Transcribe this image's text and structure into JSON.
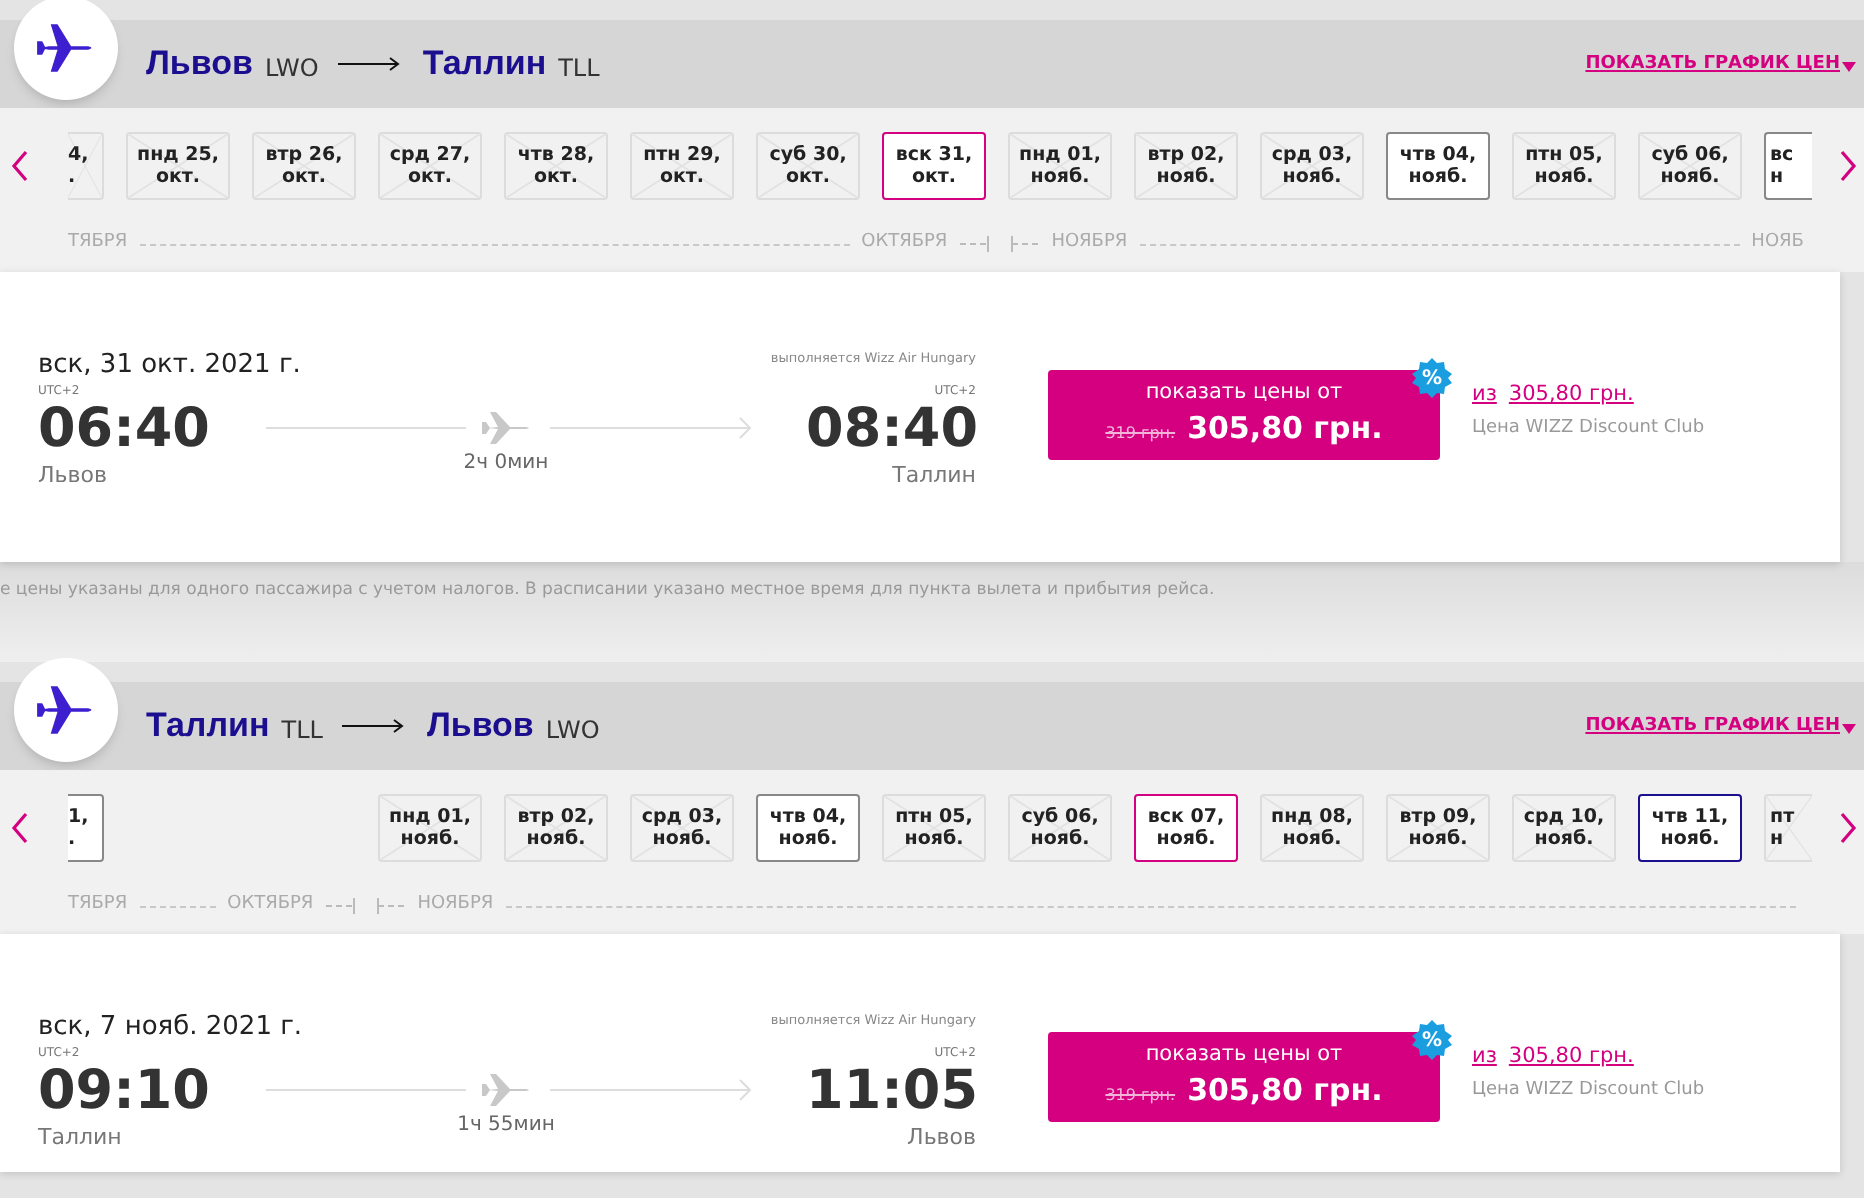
{
  "note": "е цены указаны для одного пассажира с учетом налогов. В расписании указано местное время для пункта вылета и прибытия рейса.",
  "sections": [
    {
      "route": {
        "from": "Львов",
        "from_code": "LWO",
        "to": "Таллин",
        "to_code": "TLL"
      },
      "price_chart_link": "ПОКАЗАТЬ ГРАФИК ЦЕН",
      "dates": [
        {
          "day": "4,",
          "month": ".",
          "selected": false,
          "available": false,
          "highlighted": false
        },
        {
          "day": "пнд 25,",
          "month": "окт.",
          "selected": false,
          "available": false,
          "highlighted": false
        },
        {
          "day": "втр 26,",
          "month": "окт.",
          "selected": false,
          "available": false,
          "highlighted": false
        },
        {
          "day": "срд 27,",
          "month": "окт.",
          "selected": false,
          "available": false,
          "highlighted": false
        },
        {
          "day": "чтв 28,",
          "month": "окт.",
          "selected": false,
          "available": false,
          "highlighted": false
        },
        {
          "day": "птн 29,",
          "month": "окт.",
          "selected": false,
          "available": false,
          "highlighted": false
        },
        {
          "day": "суб 30,",
          "month": "окт.",
          "selected": false,
          "available": false,
          "highlighted": false
        },
        {
          "day": "вск 31,",
          "month": "окт.",
          "selected": true,
          "available": true,
          "highlighted": false
        },
        {
          "day": "пнд 01,",
          "month": "нояб.",
          "selected": false,
          "available": false,
          "highlighted": false
        },
        {
          "day": "втр 02,",
          "month": "нояб.",
          "selected": false,
          "available": false,
          "highlighted": false
        },
        {
          "day": "срд 03,",
          "month": "нояб.",
          "selected": false,
          "available": false,
          "highlighted": false
        },
        {
          "day": "чтв 04,",
          "month": "нояб.",
          "selected": false,
          "available": true,
          "highlighted": false
        },
        {
          "day": "птн 05,",
          "month": "нояб.",
          "selected": false,
          "available": false,
          "highlighted": false
        },
        {
          "day": "суб 06,",
          "month": "нояб.",
          "selected": false,
          "available": false,
          "highlighted": false
        },
        {
          "day": "вс",
          "month": "н",
          "selected": false,
          "available": true,
          "highlighted": false
        }
      ],
      "months": [
        {
          "label": "ТЯБРЯ",
          "month_start": false
        },
        {
          "label": "ОКТЯБРЯ",
          "month_start": false
        },
        {
          "label": "НОЯБРЯ",
          "month_start": true
        },
        {
          "label": "НОЯБ",
          "month_start": false
        }
      ],
      "flight": {
        "date": "вск, 31 окт. 2021 г.",
        "operator": "выполняется Wizz Air Hungary",
        "dep_tz": "UTC+2",
        "dep_time": "06:40",
        "dep_city": "Львов",
        "duration": "2ч 0мин",
        "arr_tz": "UTC+2",
        "arr_time": "08:40",
        "arr_city": "Таллин",
        "button_label": "показать цены от",
        "old_price": "319 грн.",
        "price": "305,80 грн.",
        "badge": "%",
        "club_prefix": "из",
        "club_price": "305,80 грн.",
        "club_label": "Цена WIZZ Discount Club"
      }
    },
    {
      "route": {
        "from": "Таллин",
        "from_code": "TLL",
        "to": "Львов",
        "to_code": "LWO"
      },
      "price_chart_link": "ПОКАЗАТЬ ГРАФИК ЦЕН",
      "dates": [
        {
          "day": "1,",
          "month": ".",
          "selected": false,
          "available": true,
          "highlighted": false
        },
        {
          "day": "пнд 01,",
          "month": "нояб.",
          "selected": false,
          "available": false,
          "highlighted": false
        },
        {
          "day": "втр 02,",
          "month": "нояб.",
          "selected": false,
          "available": false,
          "highlighted": false
        },
        {
          "day": "срд 03,",
          "month": "нояб.",
          "selected": false,
          "available": false,
          "highlighted": false
        },
        {
          "day": "чтв 04,",
          "month": "нояб.",
          "selected": false,
          "available": true,
          "highlighted": false
        },
        {
          "day": "птн 05,",
          "month": "нояб.",
          "selected": false,
          "available": false,
          "highlighted": false
        },
        {
          "day": "суб 06,",
          "month": "нояб.",
          "selected": false,
          "available": false,
          "highlighted": false
        },
        {
          "day": "вск 07,",
          "month": "нояб.",
          "selected": true,
          "available": true,
          "highlighted": false
        },
        {
          "day": "пнд 08,",
          "month": "нояб.",
          "selected": false,
          "available": false,
          "highlighted": false
        },
        {
          "day": "втр 09,",
          "month": "нояб.",
          "selected": false,
          "available": false,
          "highlighted": false
        },
        {
          "day": "срд 10,",
          "month": "нояб.",
          "selected": false,
          "available": false,
          "highlighted": false
        },
        {
          "day": "чтв 11,",
          "month": "нояб.",
          "selected": false,
          "available": true,
          "highlighted": true
        },
        {
          "day": "пт",
          "month": "н",
          "selected": false,
          "available": false,
          "highlighted": false
        }
      ],
      "months": [
        {
          "label": "ТЯБРЯ",
          "month_start": false
        },
        {
          "label": "ОКТЯБРЯ",
          "month_start": false
        },
        {
          "label": "НОЯБРЯ",
          "month_start": true
        }
      ],
      "flight": {
        "date": "вск, 7 нояб. 2021 г.",
        "operator": "выполняется Wizz Air Hungary",
        "dep_tz": "UTC+2",
        "dep_time": "09:10",
        "dep_city": "Таллин",
        "duration": "1ч 55мин",
        "arr_tz": "UTC+2",
        "arr_time": "11:05",
        "arr_city": "Львов",
        "button_label": "показать цены от",
        "old_price": "319 грн.",
        "price": "305,80 грн.",
        "badge": "%",
        "club_prefix": "из",
        "club_price": "305,80 грн.",
        "club_label": "Цена WIZZ Discount Club"
      }
    }
  ]
}
